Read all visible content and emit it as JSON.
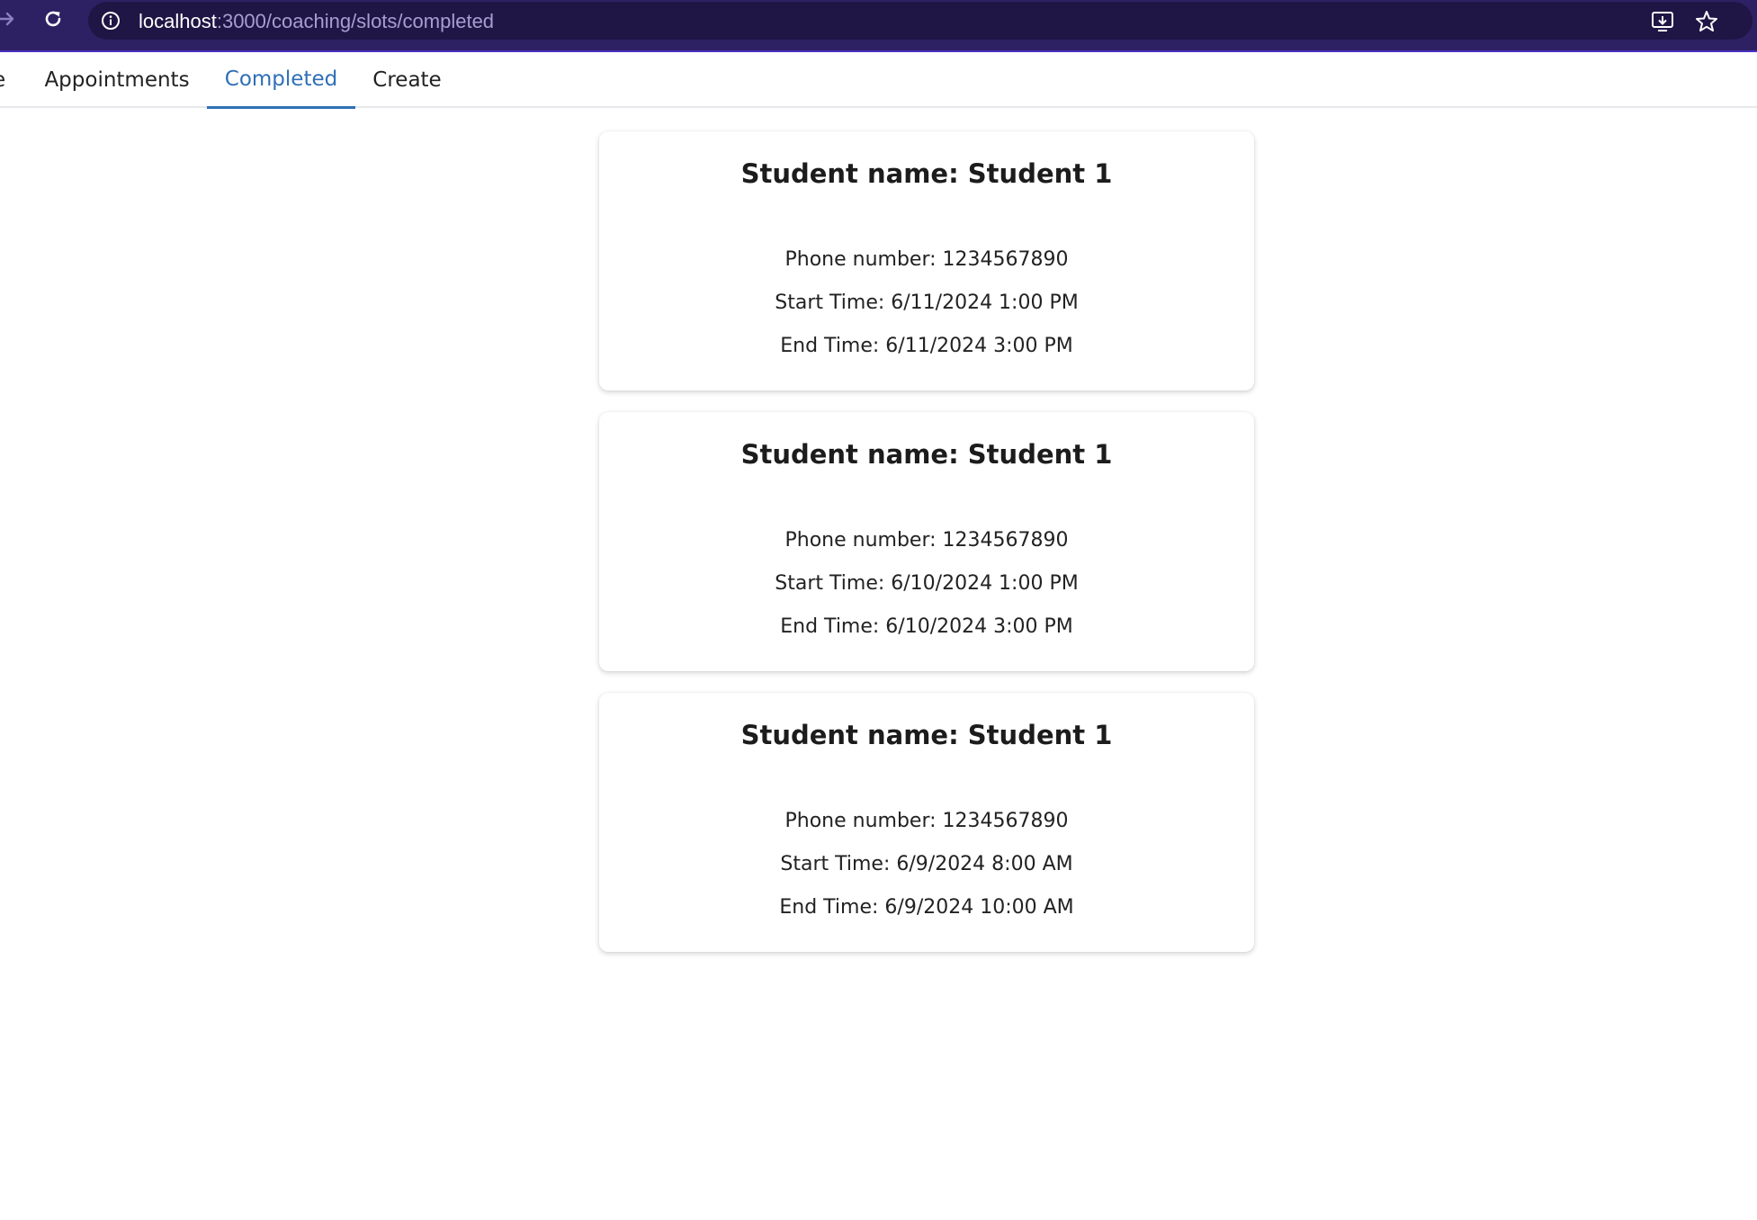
{
  "browser": {
    "url_host": "localhost",
    "url_rest": ":3000/coaching/slots/completed"
  },
  "tabs": [
    {
      "label": "e",
      "active": false
    },
    {
      "label": "Appointments",
      "active": false
    },
    {
      "label": "Completed",
      "active": true
    },
    {
      "label": "Create",
      "active": false
    }
  ],
  "cards": [
    {
      "title": "Student name: Student 1",
      "phone": "Phone number: 1234567890",
      "start": "Start Time: 6/11/2024 1:00 PM",
      "end": "End Time: 6/11/2024 3:00 PM"
    },
    {
      "title": "Student name: Student 1",
      "phone": "Phone number: 1234567890",
      "start": "Start Time: 6/10/2024 1:00 PM",
      "end": "End Time: 6/10/2024 3:00 PM"
    },
    {
      "title": "Student name: Student 1",
      "phone": "Phone number: 1234567890",
      "start": "Start Time: 6/9/2024 8:00 AM",
      "end": "End Time: 6/9/2024 10:00 AM"
    }
  ],
  "colors": {
    "chrome_bg": "#2d2163",
    "active_tab": "#2f6fb7"
  },
  "icons": [
    "forward-arrow-icon",
    "reload-icon",
    "info-icon",
    "install-app-icon",
    "star-icon"
  ]
}
